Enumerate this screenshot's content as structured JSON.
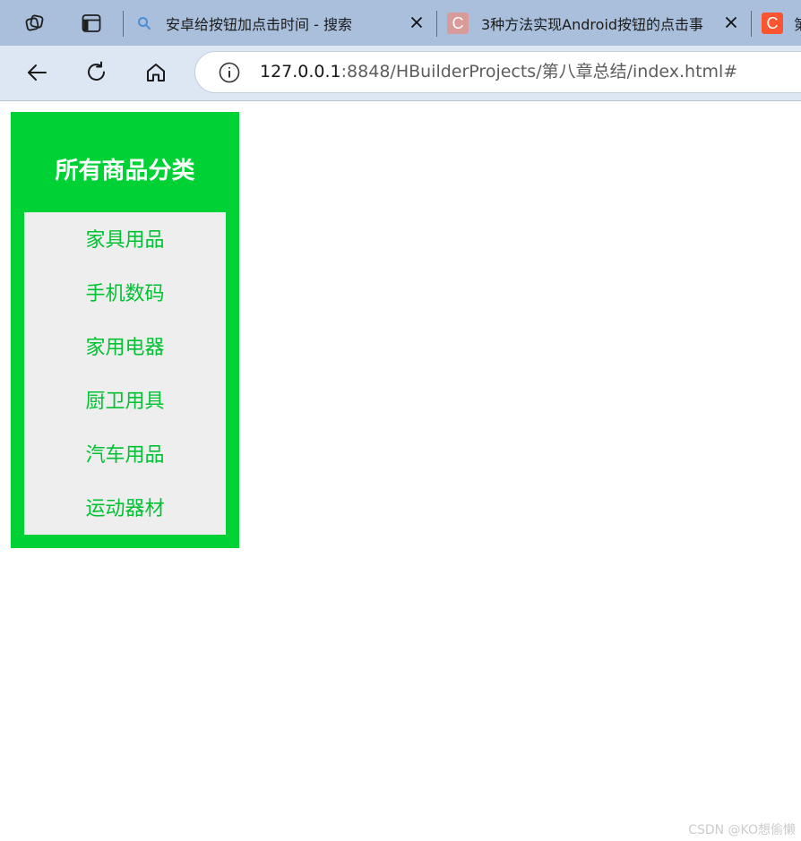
{
  "browser": {
    "tabs": [
      {
        "title": "安卓给按钮加点击时间 - 搜索",
        "favicon": "search-icon"
      },
      {
        "title": "3种方法实现Android按钮的点击事",
        "favicon": "csdn-c-icon"
      },
      {
        "title": "第",
        "favicon": "csdn-c-icon"
      }
    ],
    "address": {
      "host": "127.0.0.1",
      "rest": ":8848/HBuilderProjects/第八章总结/index.html#"
    }
  },
  "page": {
    "menu": {
      "title": "所有商品分类",
      "items": [
        {
          "label": "家具用品"
        },
        {
          "label": "手机数码"
        },
        {
          "label": "家用电器"
        },
        {
          "label": "厨卫用具"
        },
        {
          "label": "汽车用品"
        },
        {
          "label": "运动器材"
        }
      ]
    },
    "watermark": "CSDN @KO想偷懒"
  },
  "colors": {
    "menu_bg": "#00d135",
    "menu_list_bg": "#eeeeee",
    "menu_item_text": "#00c232",
    "tabbar_bg": "#a9bfdc",
    "navbar_bg": "#dde7f4",
    "csdn_brand": "#fc5531"
  }
}
